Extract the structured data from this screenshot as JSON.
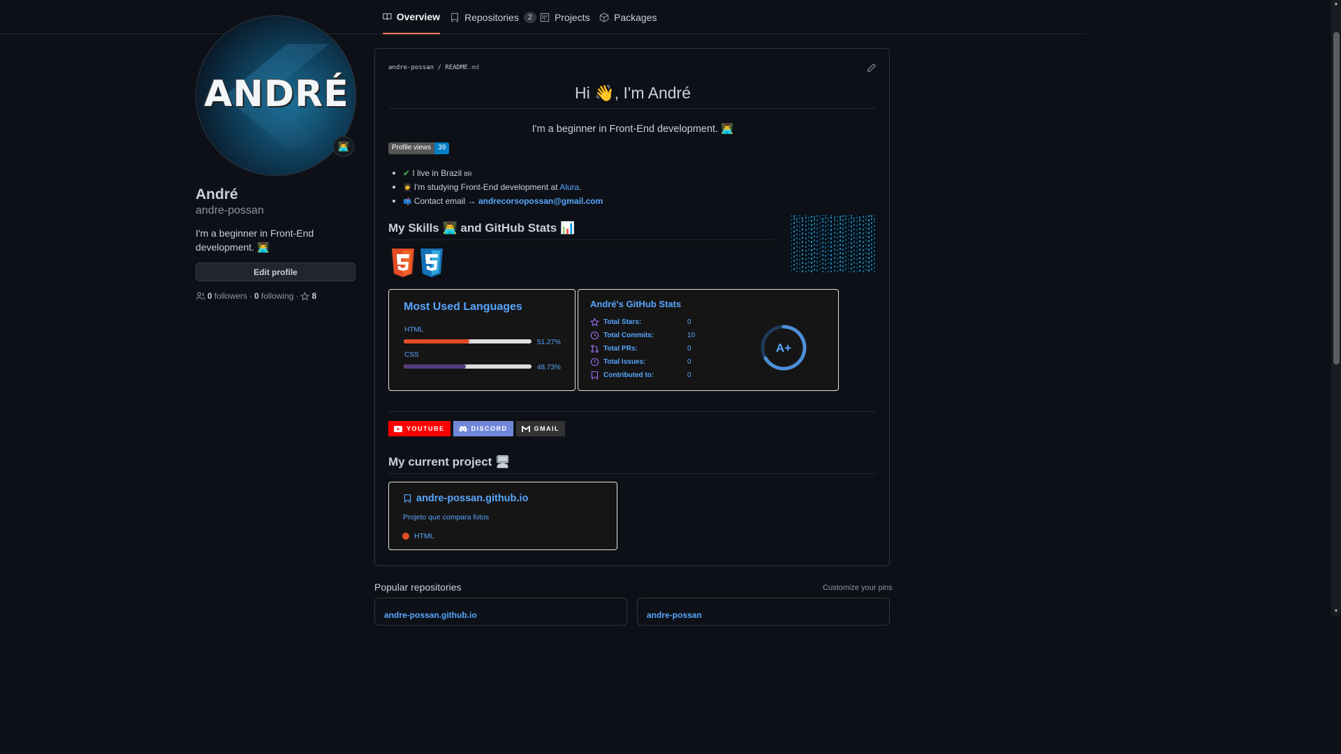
{
  "nav": {
    "tabs": [
      {
        "label": "Overview",
        "icon": "book-icon",
        "active": true
      },
      {
        "label": "Repositories",
        "icon": "repo-icon",
        "count": "2"
      },
      {
        "label": "Projects",
        "icon": "project-icon"
      },
      {
        "label": "Packages",
        "icon": "package-icon"
      }
    ]
  },
  "profile": {
    "avatar_text": "ANDRÉ",
    "status_emoji": "👨‍💻",
    "fullname": "André",
    "login": "andre-possan",
    "bio": "I'm a beginner in Front-End development. 👨‍💻",
    "edit_label": "Edit profile",
    "followers_count": "0",
    "followers_label": "followers",
    "following_count": "0",
    "following_label": "following",
    "stars_count": "8"
  },
  "readme": {
    "path_user": "andre-possan",
    "path_sep": " / ",
    "path_file": "README",
    "path_ext": ".md",
    "title": "Hi 👋, I'm André",
    "lead": "I'm a beginner in Front-End development. 👨‍💻",
    "views_label": "Profile views",
    "views_count": "39",
    "bullets": [
      {
        "icon": "✔",
        "text": "I live in Brazil ",
        "flag": "BR"
      },
      {
        "icon": "🧑‍🎓",
        "text": "I'm studying Front-End development at ",
        "link": "Alura",
        "suffix": "."
      },
      {
        "icon": "📫",
        "text": "Contact email → ",
        "link": "andrecorsopossan@gmail.com"
      }
    ],
    "skills_heading": "My Skills 👨‍💻 and GitHub Stats 📊",
    "langs_card": {
      "title": "Most Used Languages",
      "items": [
        {
          "name": "HTML",
          "percent": 51.27,
          "label": "51.27%",
          "color": "#e34c26"
        },
        {
          "name": "CSS",
          "percent": 48.73,
          "label": "48.73%",
          "color": "#563d7c"
        }
      ]
    },
    "stats_card": {
      "title": "André's GitHub Stats",
      "grade": "A+",
      "rows": [
        {
          "label": "Total Stars:",
          "value": "0",
          "icon": "star-icon"
        },
        {
          "label": "Total Commits:",
          "value": "10",
          "icon": "history-icon"
        },
        {
          "label": "Total PRs:",
          "value": "0",
          "icon": "pull-request-icon"
        },
        {
          "label": "Total Issues:",
          "value": "0",
          "icon": "issue-icon"
        },
        {
          "label": "Contributed to:",
          "value": "0",
          "icon": "repo-icon"
        }
      ]
    },
    "badges": [
      {
        "label": "YOUTUBE",
        "color": "#ff0000",
        "icon": "youtube-icon"
      },
      {
        "label": "DISCORD",
        "color": "#7289da",
        "icon": "discord-icon"
      },
      {
        "label": "GMAIL",
        "color": "#333333",
        "icon": "gmail-icon"
      }
    ],
    "project_heading": "My current project 🖥",
    "project": {
      "name": "andre-possan.github.io",
      "description": "Projeto que compara fotos",
      "language": "HTML"
    }
  },
  "popular": {
    "heading": "Popular repositories",
    "customize": "Customize your pins",
    "pins": [
      "andre-possan.github.io",
      "andre-possan"
    ]
  }
}
